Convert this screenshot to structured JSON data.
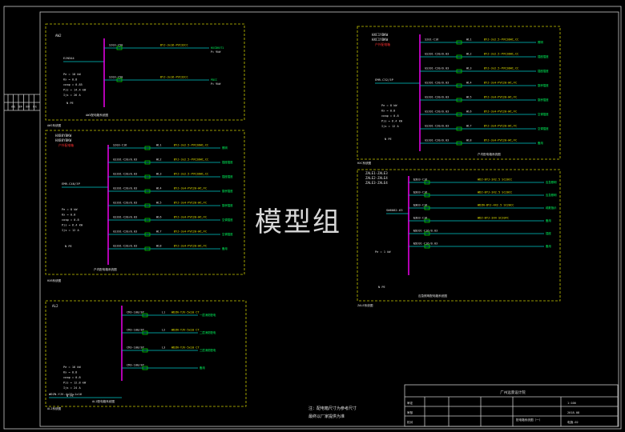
{
  "watermark": "模型组",
  "colors": {
    "frame": "#c8c8c8",
    "panel_border": "#c8c800",
    "busbar": "#ff00ff",
    "feeder": "#00c8c8",
    "text": "#e0e0e0",
    "label_red": "#ff3030",
    "label_yellow": "#e0e000",
    "breaker_green": "#00d000",
    "load_text": "#00ff60"
  },
  "panels": [
    {
      "id": "AW2",
      "title": [
        "AW2"
      ],
      "title_note": "",
      "incoming": "EJN344",
      "params": [
        "Pe = 18 kW",
        "Kx = 0.8",
        "cosφ = 0.85",
        "Pjs = 14.4 kW",
        "Ijs = 26 A"
      ],
      "circuits": [
        {
          "breaker": "S203-C50",
          "cable": "BYJ-3x16-PVC32CC",
          "load": "HXCDHXT1",
          "kw": "P= 9kW"
        },
        {
          "breaker": "S203-C50",
          "cable": "BYJ-3x16-PVC32CC",
          "load": "PDCC",
          "kw": "P= 9kW"
        }
      ],
      "caption": "AW2配电箱系统图",
      "pe_label": "N  PE"
    },
    {
      "id": "HXB",
      "title": [
        "HXB8YBKW",
        "HXB8YBKW"
      ],
      "title_note": "户外配电箱",
      "incoming": "EMR-C40/3P",
      "params": [
        "Pe = 8 kW",
        "Kx = 0.8",
        "cosφ = 0.8",
        "Pjs = 6.4 kW",
        "Ijs = 12 A"
      ],
      "circuits": [
        {
          "breaker": "S203-C16",
          "phase": "WL1",
          "cable": "BYJ-3x2.5-PVC20WC,CC",
          "load": "照明"
        },
        {
          "breaker": "GS201-C20/0.03",
          "phase": "WL2",
          "cable": "BYJ-3x2.5-PVC20WC,CC",
          "load": "插座插座"
        },
        {
          "breaker": "GS201-C20/0.03",
          "phase": "WL3",
          "cable": "BYJ-3x2.5-PVC20WC,CC",
          "load": "插座插座"
        },
        {
          "breaker": "GS201-C20/0.03",
          "phase": "WL4",
          "cable": "BYJ-3x4-PVC20-WC,FC",
          "load": "厨房插座"
        },
        {
          "breaker": "GS201-C20/0.03",
          "phase": "WL5",
          "cable": "BYJ-3x4-PVC20-WC,FC",
          "load": "厨房插座"
        },
        {
          "breaker": "GS201-C20/0.03",
          "phase": "WL6",
          "cable": "BYJ-3x4-PVC20-WC,FC",
          "load": "空调插座"
        },
        {
          "breaker": "GS201-C20/0.03",
          "phase": "WL7",
          "cable": "BYJ-3x4-PVC20-WC,FC",
          "load": "空调插座"
        },
        {
          "breaker": "GS201-C20/0.03",
          "phase": "WL8",
          "cable": "BYJ-3x4-PVC20-WC,FC",
          "load": "备用"
        }
      ],
      "caption": "户内配电箱系统图",
      "pe_label": "N  PE"
    },
    {
      "id": "AL2",
      "title": [
        "AL2"
      ],
      "title_note": "",
      "incoming": "WDZN-YJV-4x25+1x16",
      "params": [
        "Pe = 16 kW",
        "Kx = 0.8",
        "cosφ = 0.8",
        "Pjs = 12.8 kW",
        "Ijs = 24 A"
      ],
      "circuits": [
        {
          "breaker": "CM3-100/3P",
          "phase": "L1",
          "cable": "WDZN-YJV-5x10 CT",
          "load": "一层消防配电"
        },
        {
          "breaker": "CM3-100/3P",
          "phase": "L2",
          "cable": "WDZN-YJV-5x10 CT",
          "load": "二层消防配电"
        },
        {
          "breaker": "CM3-100/3P",
          "phase": "L3",
          "cable": "WDZN-YJV-5x10 CT",
          "load": "三层消防配电"
        },
        {
          "breaker": "CM3-100/3P",
          "phase": "",
          "cable": "",
          "load": "备用"
        }
      ],
      "caption": "AL2配电箱系统图",
      "pe_label": "N  PE"
    },
    {
      "id": "HXC",
      "title": [
        "HXC1YBKW",
        "HXC1YBKW"
      ],
      "title_note": "户外配电箱",
      "incoming": "EMR-C32/3P",
      "params": [
        "Pe = 8 kW",
        "Kx = 0.8",
        "cosφ = 0.8",
        "Pjs = 6.4 kW",
        "Ijs = 12 A"
      ],
      "circuits": [
        {
          "breaker": "S201-C16",
          "phase": "WL1",
          "cable": "BYJ-3x2.5-PVC20WC,CC",
          "load": "照明"
        },
        {
          "breaker": "GS201-C20/0.03",
          "phase": "WL2",
          "cable": "BYJ-3x2.5-PVC20WC,CC",
          "load": "插座插座"
        },
        {
          "breaker": "GS201-C20/0.03",
          "phase": "WL3",
          "cable": "BYJ-3x2.5-PVC20WC,CC",
          "load": "插座插座"
        },
        {
          "breaker": "GS201-C20/0.03",
          "phase": "WL4",
          "cable": "BYJ-3x4-PVC20-WC,FC",
          "load": "厨房插座"
        },
        {
          "breaker": "GS201-C20/0.03",
          "phase": "WL5",
          "cable": "BYJ-3x4-PVC20-WC,FC",
          "load": "厨房插座"
        },
        {
          "breaker": "GS201-C20/0.03",
          "phase": "WL6",
          "cable": "BYJ-3x4-PVC20-WC,FC",
          "load": "空调插座"
        },
        {
          "breaker": "GS201-C20/0.03",
          "phase": "WL7",
          "cable": "BYJ-3x4-PVC20-WC,FC",
          "load": "空调插座"
        },
        {
          "breaker": "GS201-C20/0.03",
          "phase": "WL8",
          "cable": "BYJ-3x4-PVC20-WC,FC",
          "load": "备用"
        }
      ],
      "caption": "户内配电箱系统图",
      "pe_label": "N  PE"
    },
    {
      "id": "ZALE",
      "title": [
        "ZALE1-ZALE3",
        "ZALE2-ZALE4",
        "ZALE3-ZALE4"
      ],
      "title_note": "",
      "incoming": "SW6082-63",
      "params": [
        "Pe = 1 kW"
      ],
      "circuits": [
        {
          "breaker": "S203-C16",
          "phase": "L1",
          "cable": "WDZ-BYJ-3X2.5 SC20CC",
          "load": "应急照明"
        },
        {
          "breaker": "S203-C16",
          "phase": "L2",
          "cable": "WDZ-BYJ-3X2.5 SC20CC",
          "load": "应急照明"
        },
        {
          "breaker": "S203-C16",
          "phase": "L3",
          "cable": "WDZN-BYJ-4X2.5 SC20CC",
          "load": "疏散指示"
        },
        {
          "breaker": "S203-C16",
          "phase": "L1",
          "cable": "WDZ-BYJ-3X4 SC20FC",
          "load": "备用"
        },
        {
          "breaker": "GS201-C16/0.03",
          "phase": "L2",
          "cable": "",
          "load": "插座"
        },
        {
          "breaker": "GS201-C16/0.03",
          "phase": "L3",
          "cable": "",
          "load": "备用"
        }
      ],
      "caption": "应急照明配电箱系统图",
      "pe_label": "N  PE"
    }
  ],
  "notes": [
    "注：配电箱尺寸为参考尺寸",
    "最终以厂家提供为准"
  ],
  "title_block": {
    "company": "广州远景设计院",
    "rows": [
      "审定",
      "审核",
      "校对",
      "设计",
      "制图"
    ],
    "drawing": "配电箱系统图（一）",
    "scale": "1:100",
    "date": "2018.08",
    "sheet": "电施-02"
  },
  "left_strip": [
    "修改",
    "版本",
    "日期",
    "签名"
  ]
}
